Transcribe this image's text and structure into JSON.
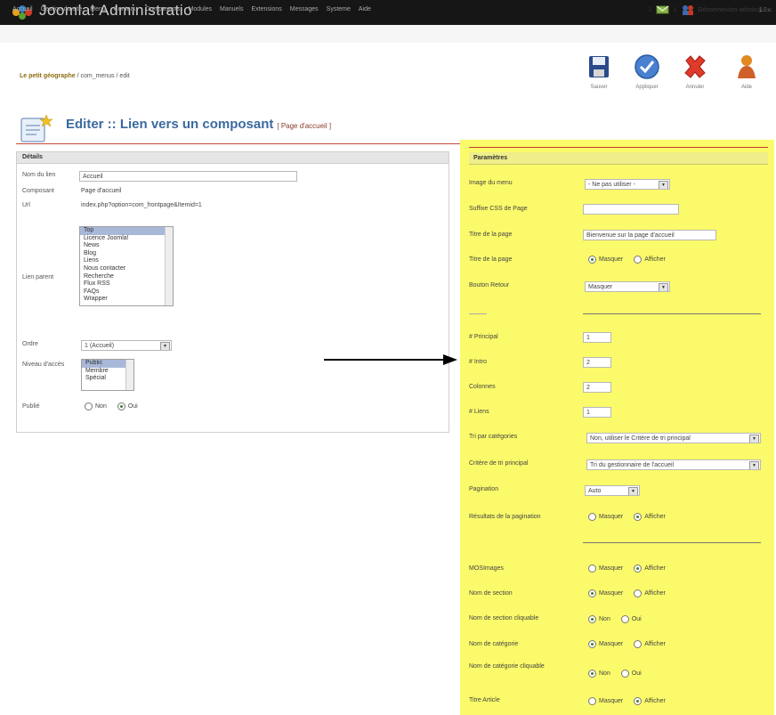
{
  "header": {
    "logo_text": "Joomla! Administratio",
    "version": "1.5.x",
    "menu": [
      "Accueil",
      "Gestion du site",
      "Menu",
      "Contenu",
      "Composants",
      "Modules",
      "Manuels",
      "Extensions",
      "Messages",
      "Systeme",
      "Aide"
    ],
    "status_count_1": "1",
    "status_count_2": "1",
    "logout": "Déconnexion admin@loc"
  },
  "breadcrumb": {
    "site": "Le petit géographe",
    "path": " / com_menus / edit"
  },
  "toolbar": {
    "save": "Sauver",
    "apply": "Appliquer",
    "cancel": "Annuler",
    "help": "Aide"
  },
  "page": {
    "title": "Editer :: Lien vers un composant",
    "subtitle": "[ Page d'accueil ]"
  },
  "details": {
    "heading": "Détails",
    "name_label": "Nom du lien",
    "name_value": "Accueil",
    "component_label": "Composant",
    "component_value": "Page d'accueil",
    "url_label": "Url",
    "url_value": "index.php?option=com_frontpage&Itemid=1",
    "parent_label": "Lien parent",
    "parent_items": [
      "Top",
      "Licence Joomla!",
      "News",
      "Blog",
      "Liens",
      "Nous contacter",
      "Recherche",
      "Flux RSS",
      "FAQs",
      "Wrapper"
    ],
    "order_label": "Ordre",
    "order_value": "1 (Accueil)",
    "access_label": "Niveau d'accès",
    "access_items": [
      "Public",
      "Membre",
      "Spécial"
    ],
    "published_label": "Publié",
    "published_no": "Non",
    "published_yes": "Oui"
  },
  "params": {
    "heading": "Paramètres",
    "rows": {
      "menu_image": {
        "label": "Image du menu",
        "value": "- Ne pas utiliser -"
      },
      "page_class": {
        "label": "Suffixe CSS de Page",
        "value": ""
      },
      "page_title": {
        "label": "Titre de la page",
        "value": "Bienvenue sur la page d'accueil"
      },
      "show_title": {
        "label": "Titre de la page",
        "opt1": "Masquer",
        "opt2": "Afficher"
      },
      "back_button": {
        "label": "Bouton Retour",
        "value": "Masquer"
      },
      "leading": {
        "label": "# Principal",
        "value": "1"
      },
      "intro": {
        "label": "# Intro",
        "value": "2"
      },
      "columns": {
        "label": "Colonnes",
        "value": "2"
      },
      "links": {
        "label": "# Liens",
        "value": "1"
      },
      "cat_order": {
        "label": "Tri par catégories",
        "value": "Non, utiliser le Critère de tri principal"
      },
      "primary_order": {
        "label": "Critère de tri principal",
        "value": "Tri du gestionnaire de l'accueil"
      },
      "pagination": {
        "label": "Pagination",
        "value": "Auto"
      },
      "pagination_results": {
        "label": "Résultats de la pagination",
        "opt1": "Masquer",
        "opt2": "Afficher"
      },
      "mosimages": {
        "label": "MOSImages",
        "opt1": "Masquer",
        "opt2": "Afficher"
      },
      "section_name": {
        "label": "Nom de section",
        "opt1": "Masquer",
        "opt2": "Afficher"
      },
      "section_link": {
        "label": "Nom de section cliquable",
        "opt1": "Non",
        "opt2": "Oui"
      },
      "category_name": {
        "label": "Nom de catégorie",
        "opt1": "Masquer",
        "opt2": "Afficher"
      },
      "category_link": {
        "label": "Nom de catégorie cliquable",
        "opt1": "Non",
        "opt2": "Oui"
      },
      "article_title": {
        "label": "Titre Article",
        "opt1": "Masquer",
        "opt2": "Afficher"
      }
    }
  },
  "colors": {
    "highlight": "#fbfa6a",
    "title": "#3b6aa0",
    "rule": "#c24a3a"
  }
}
